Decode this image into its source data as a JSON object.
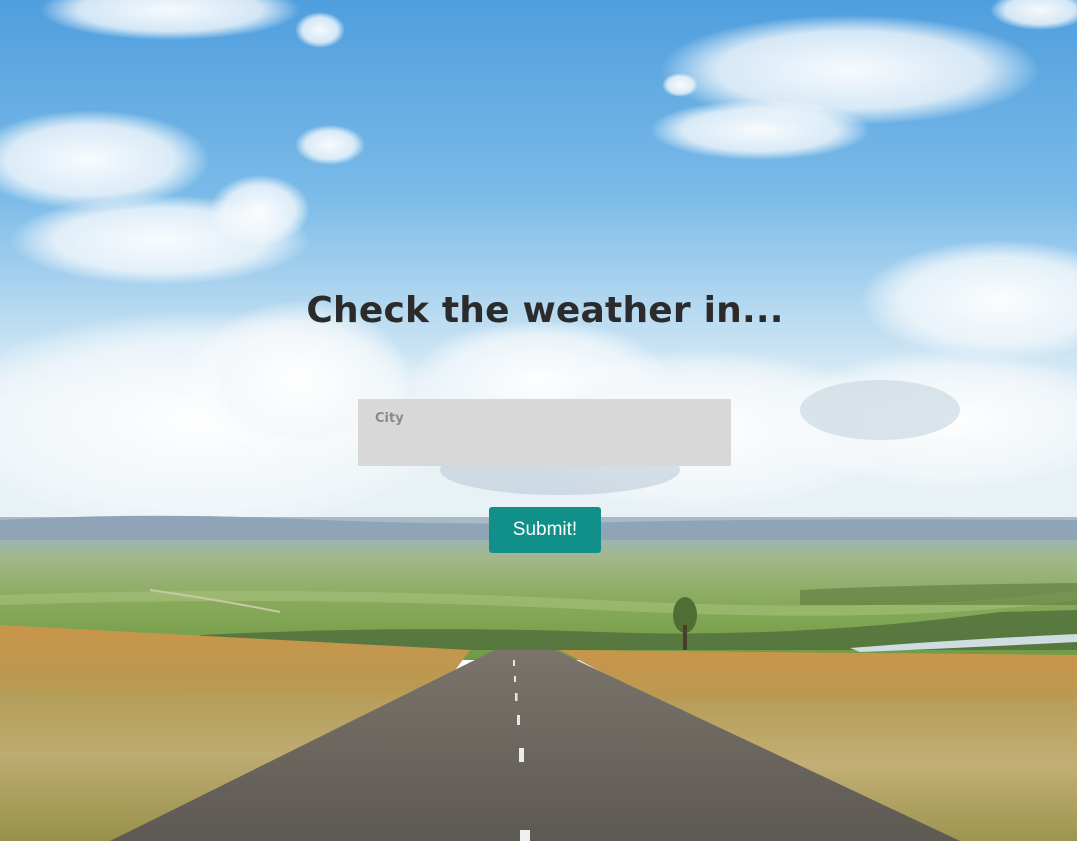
{
  "page": {
    "heading": "Check the weather in...",
    "city_input": {
      "placeholder": "City",
      "value": ""
    },
    "submit_label": "Submit!"
  },
  "colors": {
    "sky_top": "#5aa6e0",
    "sky_bottom": "#cfe6f4",
    "grass": "#8fae55",
    "road": "#6b6760",
    "input_bg": "#d8d8d8",
    "button_bg": "#11908a",
    "heading_text": "#2b2b2b"
  }
}
